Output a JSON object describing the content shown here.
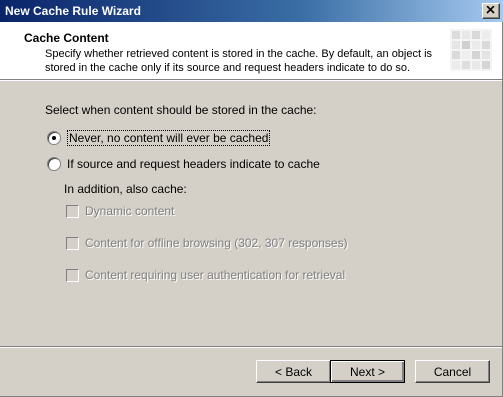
{
  "window": {
    "title": "New Cache Rule Wizard"
  },
  "header": {
    "title": "Cache Content",
    "description": "Specify whether retrieved content is stored in the cache. By default, an object is stored in the cache only if its source and request headers indicate to do so."
  },
  "body": {
    "prompt": "Select when content should be stored in the cache:",
    "options": [
      {
        "label": "Never, no content will ever be cached",
        "selected": true
      },
      {
        "label": "If source and request headers indicate to cache",
        "selected": false
      }
    ],
    "additional_label": "In addition, also cache:",
    "additional_options": [
      {
        "label": "Dynamic content",
        "checked": false,
        "enabled": false
      },
      {
        "label": "Content for offline browsing (302, 307 responses)",
        "checked": false,
        "enabled": false
      },
      {
        "label": "Content requiring user authentication for retrieval",
        "checked": false,
        "enabled": false
      }
    ]
  },
  "buttons": {
    "back": "< Back",
    "next": "Next >",
    "cancel": "Cancel"
  },
  "colors": {
    "titlebar_start": "#0a246a",
    "titlebar_end": "#a6caf0",
    "dialog_bg": "#d4d0c8"
  }
}
